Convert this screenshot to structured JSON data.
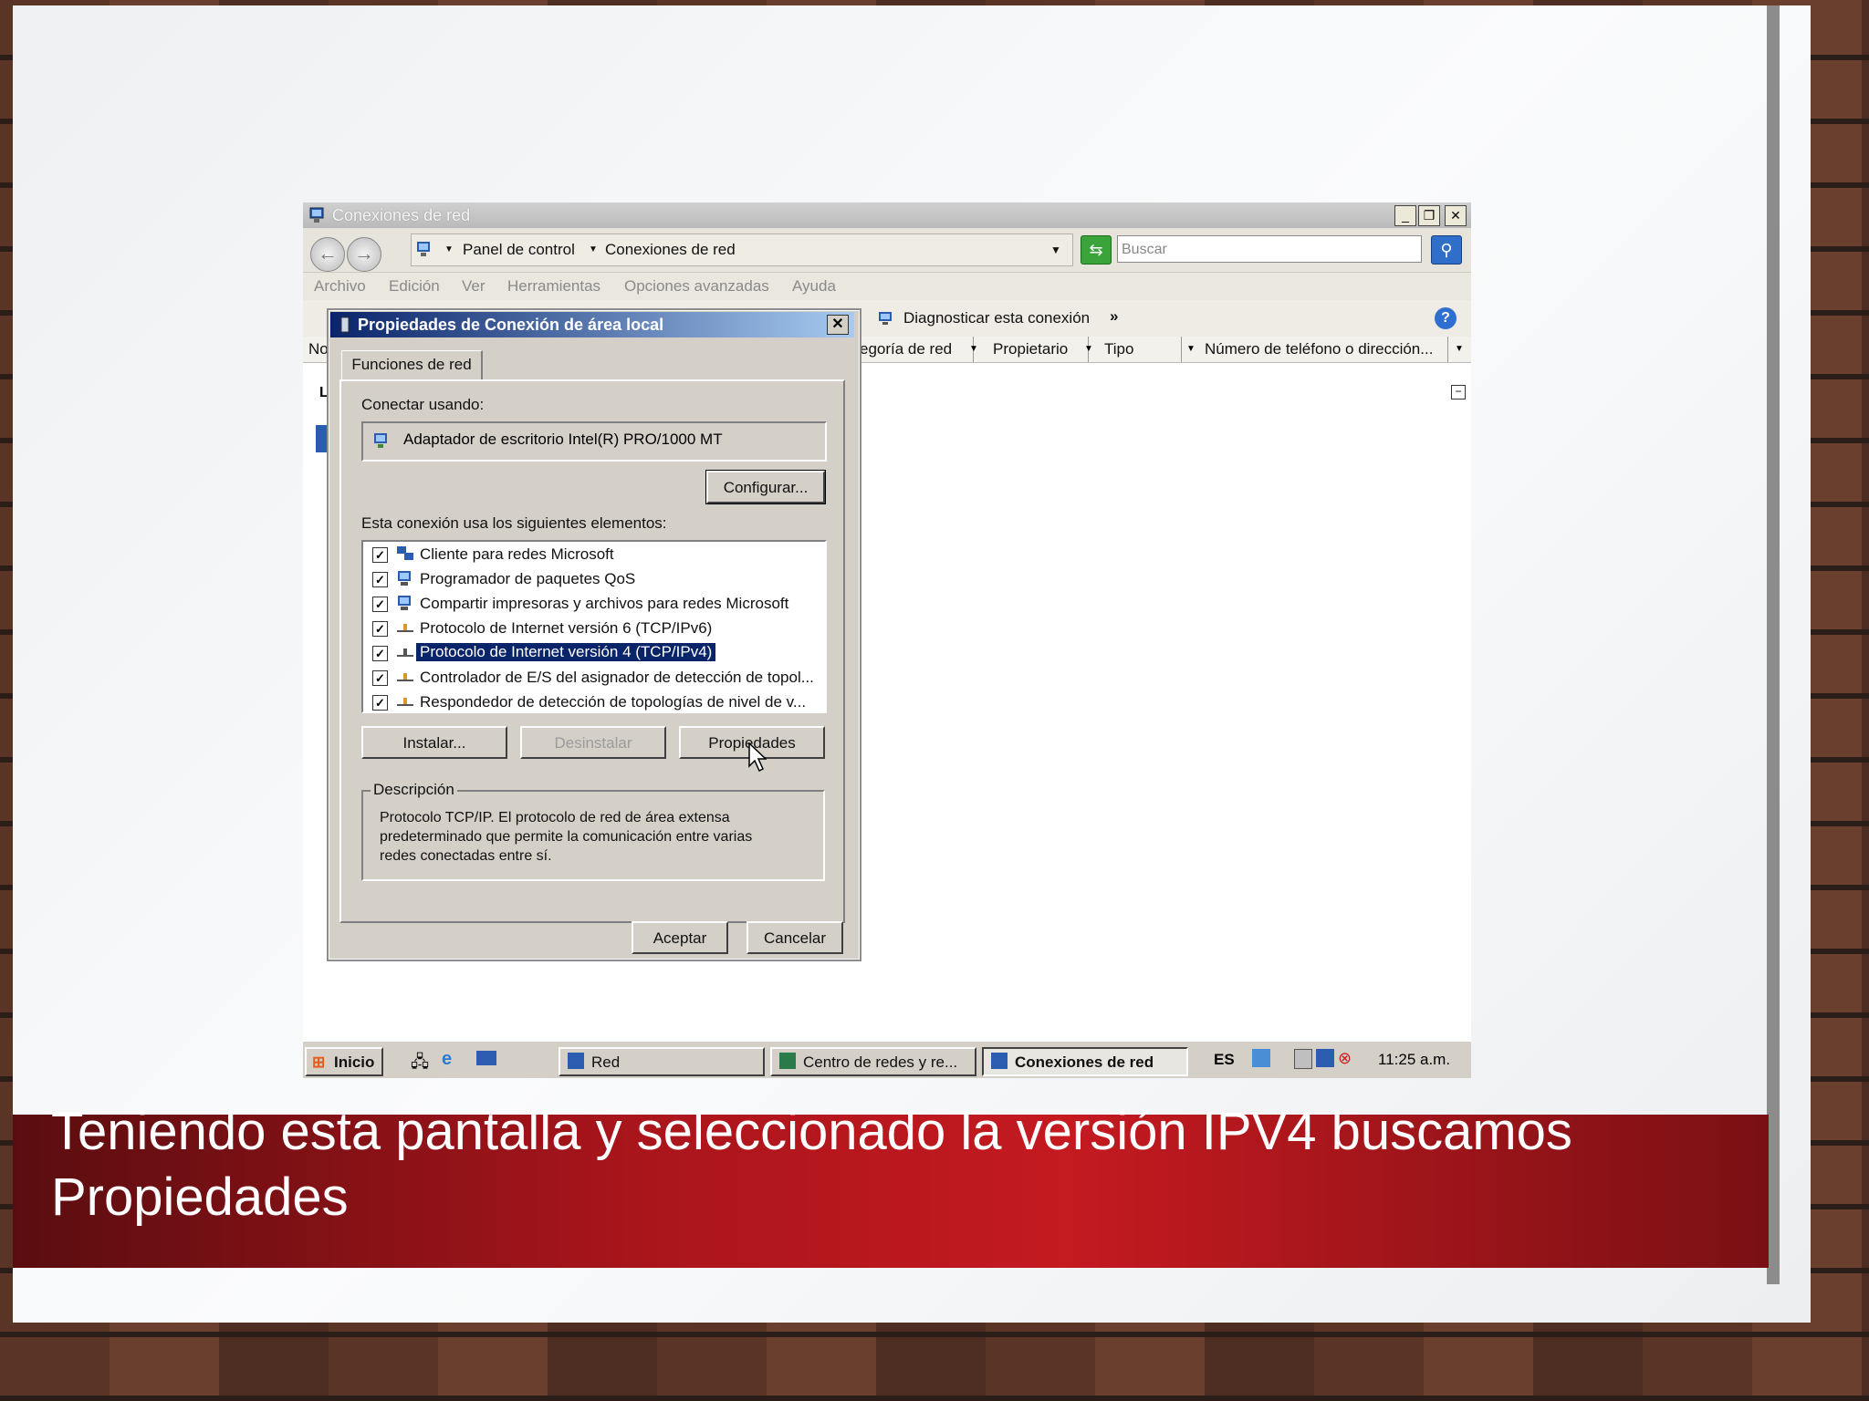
{
  "window": {
    "title": "Conexiones de red",
    "controls": {
      "minimize": "_",
      "restore": "❐",
      "close": "✕"
    }
  },
  "address": {
    "breadcrumb": [
      "Panel de control",
      "Conexiones de red"
    ],
    "search_placeholder": "Buscar"
  },
  "menu": [
    "Archivo",
    "Edición",
    "Ver",
    "Herramientas",
    "Opciones avanzadas",
    "Ayuda"
  ],
  "toolbar": {
    "diagnose_label": "Diagnosticar esta conexión",
    "more": "»",
    "help": "?"
  },
  "columns": [
    "No",
    "egoría de red",
    "Propietario",
    "Tipo",
    "Número de teléfono o dirección..."
  ],
  "left_fragment": "L",
  "dialog": {
    "title": "Propiedades de Conexión de área local",
    "close": "✕",
    "tab": "Funciones de red",
    "connect_using_label": "Conectar usando:",
    "adapter": "Adaptador de escritorio Intel(R) PRO/1000 MT",
    "configure_button": "Configurar...",
    "items_label": "Esta conexión usa los siguientes elementos:",
    "items": [
      {
        "label": "Cliente para redes Microsoft",
        "checked": true,
        "icon": "network-client-icon"
      },
      {
        "label": "Programador de paquetes QoS",
        "checked": true,
        "icon": "computer-icon"
      },
      {
        "label": "Compartir impresoras y archivos para redes Microsoft",
        "checked": true,
        "icon": "computer-icon"
      },
      {
        "label": "Protocolo de Internet versión 6 (TCP/IPv6)",
        "checked": true,
        "icon": "protocol-icon"
      },
      {
        "label": "Protocolo de Internet versión 4 (TCP/IPv4)",
        "checked": true,
        "icon": "protocol-icon",
        "selected": true
      },
      {
        "label": "Controlador de E/S del asignador de detección de topol...",
        "checked": true,
        "icon": "protocol-icon"
      },
      {
        "label": "Respondedor de detección de topologías de nivel de v...",
        "checked": true,
        "icon": "protocol-icon"
      }
    ],
    "install_button": "Instalar...",
    "uninstall_button": "Desinstalar",
    "properties_button": "Propiedades",
    "description_legend": "Descripción",
    "description_lines": [
      "Protocolo TCP/IP. El protocolo de red de área extensa",
      "predeterminado que permite la comunicación entre varias",
      "redes conectadas entre sí."
    ],
    "ok_button": "Aceptar",
    "cancel_button": "Cancelar"
  },
  "taskbar": {
    "start": "Inicio",
    "tasks": [
      "Red",
      "Centro de redes y re...",
      "Conexiones de red"
    ],
    "lang": "ES",
    "clock": "11:25 a.m."
  },
  "caption": {
    "line1": "Teniendo esta pantalla y seleccionado la versión IPV4 buscamos",
    "line2": "Propiedades"
  },
  "colors": {
    "caption_band": "#c41a20",
    "dialog_title": "#0a246a",
    "selection": "#0a246a"
  }
}
